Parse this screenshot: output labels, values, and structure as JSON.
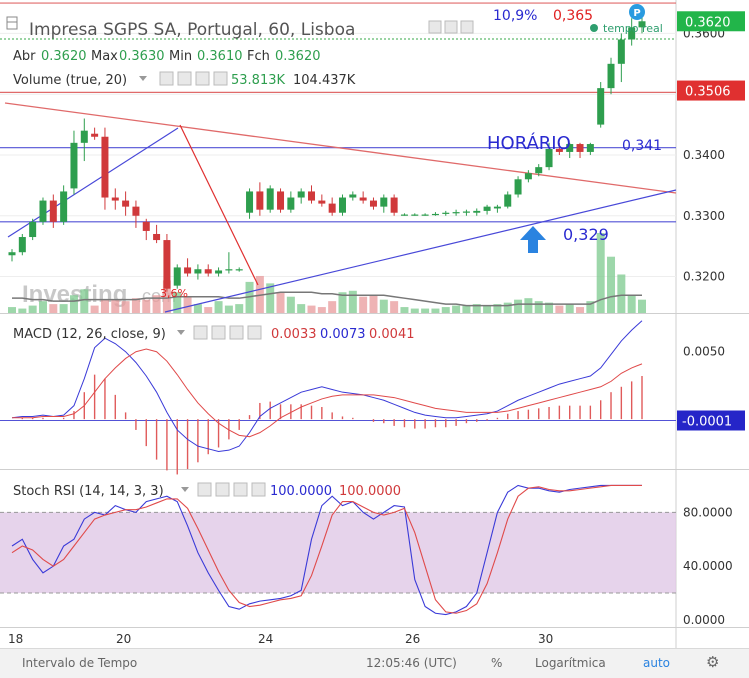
{
  "title": "Impresa SGPS SA, Portugal, 60, Lisboa",
  "live_label": "tempo real",
  "live_badge": "P",
  "ohlc": {
    "labels": [
      "Abr",
      "Max",
      "Min",
      "Fch"
    ],
    "values": [
      "0.3620",
      "0.3630",
      "0.3610",
      "0.3620"
    ]
  },
  "volume_indicator": {
    "label": "Volume (true, 20)",
    "v1": "53.813K",
    "v2": "104.437K"
  },
  "macd_indicator": {
    "label": "MACD (12, 26, close, 9)",
    "v1": "0.0033",
    "v2": "0.0073",
    "v3": "0.0041"
  },
  "stoch_indicator": {
    "label": "Stoch RSI (14, 14, 3, 3)",
    "v1": "100.0000",
    "v2": "100.0000"
  },
  "annotations": {
    "pct": "10,9%",
    "target": "0,365",
    "horario": "HORÁRIO",
    "level_341": "0,341",
    "level_329": "0,329",
    "pct_low": "3,6%"
  },
  "watermark": {
    "main": "Investing",
    "suffix": ".com"
  },
  "bottom_bar": {
    "interval": "Intervalo de Tempo",
    "clock": "12:05:46 (UTC)",
    "percent": "%",
    "log": "Logarítmica",
    "auto": "auto"
  },
  "colors": {
    "up": "#2e9e4e",
    "down": "#d0393b",
    "trend_blue": "#3f3fd8",
    "trend_red": "#e06a6a",
    "stoch_band": "#e0c8e6"
  },
  "chart_data": [
    {
      "type": "candlestick",
      "title": "Impresa SGPS SA, Portugal, 60, Lisboa",
      "x_ticks": [
        "18",
        "20",
        "24",
        "26",
        "30"
      ],
      "y_ticks": [
        "0.3600",
        "0.3500",
        "0.3400",
        "0.3300",
        "0.3200"
      ],
      "ylim": [
        0.314,
        0.3655
      ],
      "price_labels": [
        {
          "value": 0.362,
          "text": "0.3620",
          "style": "green"
        },
        {
          "value": 0.3506,
          "text": "0.3506",
          "style": "red"
        }
      ],
      "candles": [
        {
          "o": 0.3235,
          "h": 0.3245,
          "l": 0.3225,
          "c": 0.324
        },
        {
          "o": 0.324,
          "h": 0.327,
          "l": 0.3235,
          "c": 0.3265
        },
        {
          "o": 0.3265,
          "h": 0.3295,
          "l": 0.326,
          "c": 0.329
        },
        {
          "o": 0.329,
          "h": 0.333,
          "l": 0.3285,
          "c": 0.3325
        },
        {
          "o": 0.3325,
          "h": 0.3335,
          "l": 0.328,
          "c": 0.329
        },
        {
          "o": 0.329,
          "h": 0.335,
          "l": 0.3285,
          "c": 0.334
        },
        {
          "o": 0.3345,
          "h": 0.344,
          "l": 0.3335,
          "c": 0.342
        },
        {
          "o": 0.342,
          "h": 0.346,
          "l": 0.339,
          "c": 0.344
        },
        {
          "o": 0.3435,
          "h": 0.3445,
          "l": 0.3425,
          "c": 0.343
        },
        {
          "o": 0.343,
          "h": 0.3445,
          "l": 0.331,
          "c": 0.333
        },
        {
          "o": 0.333,
          "h": 0.3345,
          "l": 0.331,
          "c": 0.3325
        },
        {
          "o": 0.3325,
          "h": 0.334,
          "l": 0.33,
          "c": 0.3315
        },
        {
          "o": 0.3315,
          "h": 0.3325,
          "l": 0.328,
          "c": 0.33
        },
        {
          "o": 0.329,
          "h": 0.3295,
          "l": 0.326,
          "c": 0.3275
        },
        {
          "o": 0.327,
          "h": 0.3285,
          "l": 0.3255,
          "c": 0.326
        },
        {
          "o": 0.326,
          "h": 0.327,
          "l": 0.3175,
          "c": 0.318
        },
        {
          "o": 0.3185,
          "h": 0.322,
          "l": 0.318,
          "c": 0.3215
        },
        {
          "o": 0.3215,
          "h": 0.323,
          "l": 0.32,
          "c": 0.3205
        },
        {
          "o": 0.3205,
          "h": 0.322,
          "l": 0.3195,
          "c": 0.3212
        },
        {
          "o": 0.3212,
          "h": 0.322,
          "l": 0.32,
          "c": 0.3205
        },
        {
          "o": 0.3205,
          "h": 0.3215,
          "l": 0.32,
          "c": 0.321
        },
        {
          "o": 0.321,
          "h": 0.324,
          "l": 0.3205,
          "c": 0.3212
        },
        {
          "o": 0.3212,
          "h": 0.3215,
          "l": 0.3208,
          "c": 0.3212
        },
        {
          "o": 0.3305,
          "h": 0.3345,
          "l": 0.3295,
          "c": 0.334
        },
        {
          "o": 0.334,
          "h": 0.3355,
          "l": 0.33,
          "c": 0.331
        },
        {
          "o": 0.331,
          "h": 0.335,
          "l": 0.3305,
          "c": 0.3345
        },
        {
          "o": 0.334,
          "h": 0.3345,
          "l": 0.3305,
          "c": 0.331
        },
        {
          "o": 0.331,
          "h": 0.334,
          "l": 0.3305,
          "c": 0.333
        },
        {
          "o": 0.333,
          "h": 0.3345,
          "l": 0.332,
          "c": 0.334
        },
        {
          "o": 0.334,
          "h": 0.335,
          "l": 0.332,
          "c": 0.3325
        },
        {
          "o": 0.3325,
          "h": 0.3335,
          "l": 0.3315,
          "c": 0.332
        },
        {
          "o": 0.332,
          "h": 0.333,
          "l": 0.33,
          "c": 0.3305
        },
        {
          "o": 0.3305,
          "h": 0.3335,
          "l": 0.33,
          "c": 0.333
        },
        {
          "o": 0.333,
          "h": 0.334,
          "l": 0.3325,
          "c": 0.3335
        },
        {
          "o": 0.333,
          "h": 0.334,
          "l": 0.332,
          "c": 0.3325
        },
        {
          "o": 0.3325,
          "h": 0.333,
          "l": 0.331,
          "c": 0.3315
        },
        {
          "o": 0.3315,
          "h": 0.3335,
          "l": 0.3305,
          "c": 0.333
        },
        {
          "o": 0.333,
          "h": 0.3335,
          "l": 0.33,
          "c": 0.3305
        },
        {
          "o": 0.3302,
          "h": 0.3304,
          "l": 0.33,
          "c": 0.3302
        },
        {
          "o": 0.3302,
          "h": 0.3304,
          "l": 0.33,
          "c": 0.3302
        },
        {
          "o": 0.3302,
          "h": 0.3304,
          "l": 0.33,
          "c": 0.3302
        },
        {
          "o": 0.3302,
          "h": 0.3306,
          "l": 0.33,
          "c": 0.3303
        },
        {
          "o": 0.3303,
          "h": 0.3308,
          "l": 0.33,
          "c": 0.3305
        },
        {
          "o": 0.3305,
          "h": 0.331,
          "l": 0.33,
          "c": 0.3306
        },
        {
          "o": 0.3305,
          "h": 0.331,
          "l": 0.33,
          "c": 0.3307
        },
        {
          "o": 0.3305,
          "h": 0.3312,
          "l": 0.33,
          "c": 0.3308
        },
        {
          "o": 0.3308,
          "h": 0.3318,
          "l": 0.3302,
          "c": 0.3315
        },
        {
          "o": 0.3312,
          "h": 0.3318,
          "l": 0.3305,
          "c": 0.3315
        },
        {
          "o": 0.3315,
          "h": 0.334,
          "l": 0.3312,
          "c": 0.3335
        },
        {
          "o": 0.3335,
          "h": 0.3365,
          "l": 0.333,
          "c": 0.336
        },
        {
          "o": 0.336,
          "h": 0.3375,
          "l": 0.3355,
          "c": 0.337
        },
        {
          "o": 0.337,
          "h": 0.3385,
          "l": 0.3365,
          "c": 0.338
        },
        {
          "o": 0.338,
          "h": 0.342,
          "l": 0.3375,
          "c": 0.341
        },
        {
          "o": 0.341,
          "h": 0.342,
          "l": 0.34,
          "c": 0.3405
        },
        {
          "o": 0.3405,
          "h": 0.342,
          "l": 0.3395,
          "c": 0.3418
        },
        {
          "o": 0.3418,
          "h": 0.342,
          "l": 0.3395,
          "c": 0.3405
        },
        {
          "o": 0.3405,
          "h": 0.342,
          "l": 0.34,
          "c": 0.3418
        },
        {
          "o": 0.345,
          "h": 0.352,
          "l": 0.3445,
          "c": 0.351
        },
        {
          "o": 0.351,
          "h": 0.356,
          "l": 0.35,
          "c": 0.355
        },
        {
          "o": 0.355,
          "h": 0.36,
          "l": 0.352,
          "c": 0.359
        },
        {
          "o": 0.359,
          "h": 0.3625,
          "l": 0.358,
          "c": 0.361
        },
        {
          "o": 0.361,
          "h": 0.363,
          "l": 0.36,
          "c": 0.362
        }
      ],
      "volume": [
        4,
        3,
        5,
        8,
        6,
        6,
        12,
        16,
        5,
        9,
        9,
        8,
        10,
        9,
        12,
        22,
        14,
        11,
        6,
        4,
        8,
        5,
        6,
        21,
        25,
        20,
        14,
        11,
        6,
        5,
        4,
        8,
        14,
        15,
        11,
        12,
        9,
        8,
        4,
        3,
        3,
        3,
        4,
        5,
        5,
        6,
        5,
        6,
        7,
        9,
        10,
        8,
        7,
        5,
        6,
        4,
        8,
        54,
        38,
        26,
        12,
        9
      ],
      "volume_ma": [
        10,
        10,
        9,
        9,
        8,
        8,
        8,
        9,
        9,
        9,
        9,
        9,
        9,
        10,
        10,
        10,
        11,
        11,
        11,
        11,
        11,
        10,
        10,
        11,
        12,
        13,
        14,
        14,
        14,
        14,
        13,
        13,
        12,
        12,
        12,
        12,
        12,
        11,
        10,
        9,
        8,
        7,
        6,
        6,
        5,
        5,
        5,
        5,
        5,
        6,
        6,
        6,
        6,
        6,
        6,
        6,
        6,
        9,
        11,
        12,
        12,
        12
      ],
      "horizontal_lines": [
        {
          "value": 0.365,
          "color": "#e06a6a"
        },
        {
          "value": 0.3503,
          "color": "#e06a6a"
        },
        {
          "value": 0.3412,
          "color": "#5252d6"
        },
        {
          "value": 0.329,
          "color": "#5252d6"
        }
      ]
    },
    {
      "type": "line",
      "title": "MACD (12, 26, close, 9)",
      "y_ticks": [
        "0.0050",
        "-0.0001"
      ],
      "ylim": [
        -0.0034,
        0.0075
      ],
      "series": [
        {
          "name": "MACD",
          "color": "#3a3ad8",
          "values": [
            0.0001,
            0.0002,
            0.0002,
            0.0003,
            0.0002,
            0.0003,
            0.001,
            0.003,
            0.0053,
            0.006,
            0.0056,
            0.005,
            0.0042,
            0.0032,
            0.002,
            0.0005,
            -0.0008,
            -0.0015,
            -0.002,
            -0.0022,
            -0.0024,
            -0.0023,
            -0.002,
            -0.001,
            0.0002,
            0.0008,
            0.0012,
            0.0016,
            0.002,
            0.0022,
            0.0024,
            0.0022,
            0.002,
            0.0019,
            0.0018,
            0.0016,
            0.0014,
            0.0011,
            0.0008,
            0.0005,
            0.0003,
            0.0002,
            0.0001,
            0.0001,
            0.0002,
            0.0003,
            0.0004,
            0.0006,
            0.001,
            0.0014,
            0.0017,
            0.002,
            0.0023,
            0.0026,
            0.0028,
            0.003,
            0.0032,
            0.0038,
            0.0048,
            0.0058,
            0.0066,
            0.0073
          ]
        },
        {
          "name": "Signal",
          "color": "#e04a4a",
          "values": [
            0.0001,
            0.0001,
            0.0001,
            0.0002,
            0.0002,
            0.0002,
            0.0004,
            0.001,
            0.002,
            0.003,
            0.0038,
            0.0045,
            0.005,
            0.0052,
            0.005,
            0.0043,
            0.0033,
            0.0022,
            0.0012,
            0.0004,
            -0.0003,
            -0.0008,
            -0.0012,
            -0.0013,
            -0.001,
            -0.0005,
            0.0001,
            0.0005,
            0.0009,
            0.0012,
            0.0015,
            0.0017,
            0.0018,
            0.0018,
            0.0018,
            0.0018,
            0.0017,
            0.0016,
            0.0014,
            0.0012,
            0.001,
            0.0008,
            0.0007,
            0.0006,
            0.0005,
            0.0005,
            0.0005,
            0.0005,
            0.0006,
            0.0008,
            0.001,
            0.0012,
            0.0014,
            0.0016,
            0.0018,
            0.002,
            0.0022,
            0.0024,
            0.0028,
            0.0034,
            0.0038,
            0.0041
          ]
        }
      ]
    },
    {
      "type": "line",
      "title": "Stoch RSI (14, 14, 3, 3)",
      "y_ticks": [
        "80.0000",
        "40.0000",
        "0.0000"
      ],
      "ylim": [
        -3,
        110
      ],
      "band": [
        20,
        80
      ],
      "series": [
        {
          "name": "%K",
          "color": "#3a3ad8",
          "values": [
            55,
            60,
            45,
            35,
            40,
            55,
            60,
            75,
            80,
            78,
            85,
            82,
            80,
            88,
            90,
            92,
            88,
            70,
            50,
            35,
            22,
            10,
            8,
            12,
            14,
            15,
            16,
            18,
            22,
            60,
            85,
            92,
            85,
            88,
            80,
            75,
            80,
            85,
            84,
            30,
            10,
            5,
            4,
            6,
            10,
            20,
            50,
            80,
            95,
            100,
            98,
            98,
            96,
            95,
            97,
            98,
            99,
            100,
            100,
            100,
            100,
            100
          ]
        },
        {
          "name": "%D",
          "color": "#e04a4a",
          "values": [
            50,
            55,
            52,
            45,
            40,
            45,
            55,
            65,
            75,
            78,
            80,
            82,
            82,
            84,
            87,
            90,
            90,
            83,
            68,
            52,
            36,
            22,
            13,
            10,
            11,
            13,
            15,
            16,
            18,
            33,
            55,
            78,
            88,
            88,
            84,
            80,
            78,
            80,
            83,
            65,
            40,
            15,
            6,
            5,
            7,
            12,
            27,
            50,
            75,
            92,
            98,
            99,
            97,
            96,
            96,
            97,
            98,
            99,
            100,
            100,
            100,
            100
          ]
        }
      ]
    }
  ]
}
